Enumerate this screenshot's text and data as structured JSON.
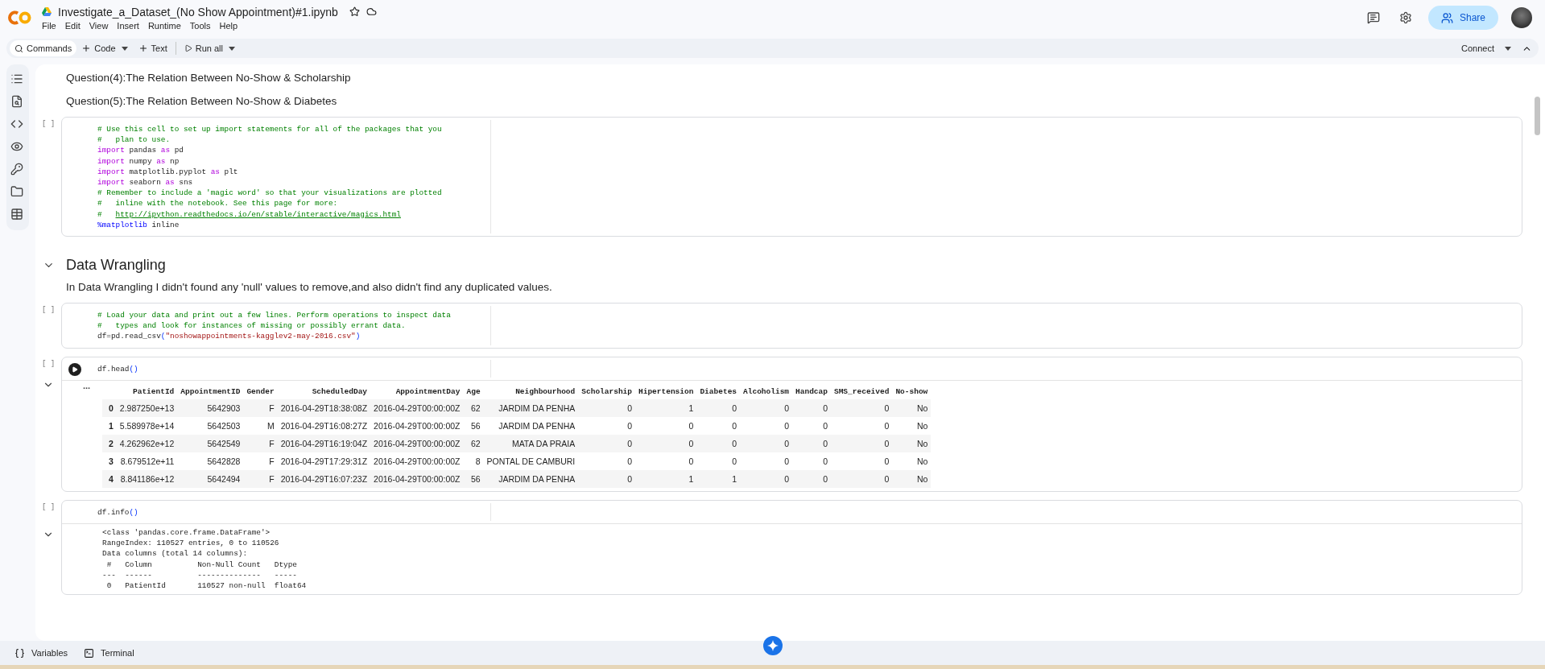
{
  "notebook": {
    "title": "Investigate_a_Dataset_(No Show Appointment)#1.ipynb",
    "starred": false
  },
  "menu": [
    "File",
    "Edit",
    "View",
    "Insert",
    "Runtime",
    "Tools",
    "Help"
  ],
  "toolbar": {
    "commands": "Commands",
    "add_code": "Code",
    "add_text": "Text",
    "run_all": "Run all",
    "connect": "Connect"
  },
  "share": "Share",
  "cells": [
    {
      "kind": "text",
      "paragraphs": [
        "Question(4):The Relation Between No-Show & Scholarship",
        "Question(5):The Relation Between No-Show & Diabetes"
      ]
    },
    {
      "kind": "code",
      "bracket": "[ ]",
      "focused": false,
      "lines": [
        [
          {
            "kind": "comment",
            "text": "# Use this cell to set up import statements for all of the packages that you"
          }
        ],
        [
          {
            "kind": "comment",
            "text": "#   plan to use."
          }
        ],
        [
          {
            "kind": "keyword",
            "text": "import"
          },
          {
            "kind": "plain",
            "text": " pandas "
          },
          {
            "kind": "keyword",
            "text": "as"
          },
          {
            "kind": "plain",
            "text": " pd"
          }
        ],
        [
          {
            "kind": "keyword",
            "text": "import"
          },
          {
            "kind": "plain",
            "text": " numpy "
          },
          {
            "kind": "keyword",
            "text": "as"
          },
          {
            "kind": "plain",
            "text": " np"
          }
        ],
        [
          {
            "kind": "keyword",
            "text": "import"
          },
          {
            "kind": "plain",
            "text": " matplotlib.pyplot "
          },
          {
            "kind": "keyword",
            "text": "as"
          },
          {
            "kind": "plain",
            "text": " plt"
          }
        ],
        [
          {
            "kind": "keyword",
            "text": "import"
          },
          {
            "kind": "plain",
            "text": " seaborn "
          },
          {
            "kind": "keyword",
            "text": "as"
          },
          {
            "kind": "plain",
            "text": " sns"
          }
        ],
        [
          {
            "kind": "comment",
            "text": "# Remember to include a 'magic word' so that your visualizations are plotted"
          }
        ],
        [
          {
            "kind": "comment",
            "text": "#   inline with the notebook. See this page for more:"
          }
        ],
        [
          {
            "kind": "comment",
            "text": "#   "
          },
          {
            "kind": "link",
            "text": "http://ipython.readthedocs.io/en/stable/interactive/magics.html"
          }
        ],
        [
          {
            "kind": "magic",
            "text": "%matplotlib"
          },
          {
            "kind": "plain",
            "text": " inline"
          }
        ]
      ]
    },
    {
      "kind": "heading",
      "text": "Data Wrangling",
      "expanded": true
    },
    {
      "kind": "text",
      "paragraphs": [
        "In Data Wrangling I didn't found any 'null' values to remove,and also didn't find any duplicated values."
      ]
    },
    {
      "kind": "code",
      "bracket": "[ ]",
      "focused": false,
      "lines": [
        [
          {
            "kind": "comment",
            "text": "# Load your data and print out a few lines. Perform operations to inspect data"
          }
        ],
        [
          {
            "kind": "comment",
            "text": "#   types and look for instances of missing or possibly errant data."
          }
        ],
        [
          {
            "kind": "plain",
            "text": "df=pd.read_csv"
          },
          {
            "kind": "paren",
            "text": "("
          },
          {
            "kind": "string",
            "text": "\"noshowappointments-kagglev2-may-2016.csv\""
          },
          {
            "kind": "paren",
            "text": ")"
          }
        ]
      ]
    },
    {
      "kind": "code",
      "bracket": "[ ]",
      "focused": true,
      "lines": [
        [
          {
            "kind": "plain",
            "text": "df.head"
          },
          {
            "kind": "paren",
            "text": "()"
          }
        ]
      ],
      "output": {
        "kind": "table",
        "expanded": true,
        "marker": "...",
        "columns": [
          "PatientId",
          "AppointmentID",
          "Gender",
          "ScheduledDay",
          "AppointmentDay",
          "Age",
          "Neighbourhood",
          "Scholarship",
          "Hipertension",
          "Diabetes",
          "Alcoholism",
          "Handcap",
          "SMS_received",
          "No-show"
        ],
        "rows": [
          {
            "index": "0",
            "cells": [
              "2.987250e+13",
              "5642903",
              "F",
              "2016-04-29T18:38:08Z",
              "2016-04-29T00:00:00Z",
              "62",
              "JARDIM DA PENHA",
              "0",
              "1",
              "0",
              "0",
              "0",
              "0",
              "No"
            ]
          },
          {
            "index": "1",
            "cells": [
              "5.589978e+14",
              "5642503",
              "M",
              "2016-04-29T16:08:27Z",
              "2016-04-29T00:00:00Z",
              "56",
              "JARDIM DA PENHA",
              "0",
              "0",
              "0",
              "0",
              "0",
              "0",
              "No"
            ]
          },
          {
            "index": "2",
            "cells": [
              "4.262962e+12",
              "5642549",
              "F",
              "2016-04-29T16:19:04Z",
              "2016-04-29T00:00:00Z",
              "62",
              "MATA DA PRAIA",
              "0",
              "0",
              "0",
              "0",
              "0",
              "0",
              "No"
            ]
          },
          {
            "index": "3",
            "cells": [
              "8.679512e+11",
              "5642828",
              "F",
              "2016-04-29T17:29:31Z",
              "2016-04-29T00:00:00Z",
              "8",
              "PONTAL DE CAMBURI",
              "0",
              "0",
              "0",
              "0",
              "0",
              "0",
              "No"
            ]
          },
          {
            "index": "4",
            "cells": [
              "8.841186e+12",
              "5642494",
              "F",
              "2016-04-29T16:07:23Z",
              "2016-04-29T00:00:00Z",
              "56",
              "JARDIM DA PENHA",
              "0",
              "1",
              "1",
              "0",
              "0",
              "0",
              "No"
            ]
          }
        ]
      }
    },
    {
      "kind": "code",
      "bracket": "[ ]",
      "focused": false,
      "lines": [
        [
          {
            "kind": "plain",
            "text": "df.info"
          },
          {
            "kind": "paren",
            "text": "()"
          }
        ]
      ],
      "output": {
        "kind": "text",
        "expanded": true,
        "lines": [
          "<class 'pandas.core.frame.DataFrame'>",
          "RangeIndex: 110527 entries, 0 to 110526",
          "Data columns (total 14 columns):",
          " #   Column          Non-Null Count   Dtype  ",
          "---  ------          --------------   -----  ",
          " 0   PatientId       110527 non-null  float64"
        ]
      }
    }
  ],
  "bottom_bar": {
    "variables": "Variables",
    "terminal": "Terminal"
  }
}
